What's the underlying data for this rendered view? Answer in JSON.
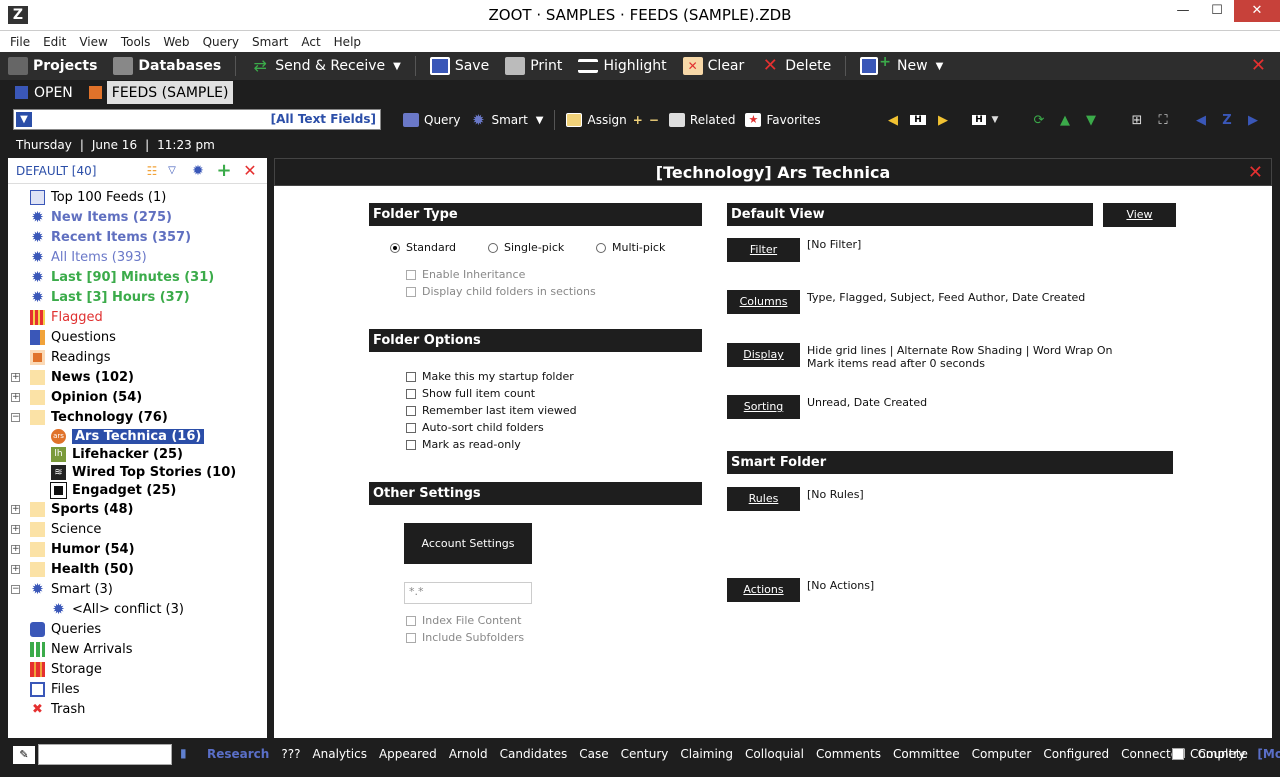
{
  "window": {
    "title": "ZOOT · SAMPLES · FEEDS (SAMPLE).ZDB",
    "minimize": "—",
    "maximize": "☐",
    "close": "✕",
    "logo": "Z"
  },
  "menu": [
    "File",
    "Edit",
    "View",
    "Tools",
    "Web",
    "Query",
    "Smart",
    "Act",
    "Help"
  ],
  "toolbar": {
    "projects": "Projects",
    "databases": "Databases",
    "send_receive": "Send & Receive",
    "save": "Save",
    "print": "Print",
    "highlight": "Highlight",
    "clear": "Clear",
    "delete": "Delete",
    "new": "New",
    "close": "✕"
  },
  "tabs": {
    "open": "OPEN",
    "active": "FEEDS (SAMPLE)"
  },
  "search": {
    "scope": "[All Text Fields]",
    "value": ""
  },
  "toolbar2": {
    "query": "Query",
    "smart": "Smart",
    "assign": "Assign",
    "related": "Related",
    "favorites": "Favorites"
  },
  "datebar": {
    "day": "Thursday",
    "date": "June 16",
    "time": "11:23 pm",
    "sep": "|"
  },
  "left": {
    "header": "DEFAULT  [40]",
    "items": {
      "top100": "Top 100 Feeds (1)",
      "new": "New Items (275)",
      "recent": "Recent Items (357)",
      "all": "All Items (393)",
      "last90": "Last [90] Minutes (31)",
      "last3": "Last [3] Hours (37)",
      "flagged": "Flagged",
      "questions": "Questions",
      "readings": "Readings",
      "news": "News (102)",
      "opinion": "Opinion (54)",
      "technology": "Technology (76)",
      "ars": "Ars Technica (16)",
      "lifehacker": "Lifehacker (25)",
      "wired": "Wired Top Stories (10)",
      "engadget": "Engadget (25)",
      "sports": "Sports (48)",
      "science": "Science",
      "humor": "Humor (54)",
      "health": "Health (50)",
      "smart": "Smart (3)",
      "conflict": "<All> conflict (3)",
      "queries": "Queries",
      "arrivals": "New Arrivals",
      "storage": "Storage",
      "files": "Files",
      "trash": "Trash"
    }
  },
  "main": {
    "title": "[Technology]  Ars Technica",
    "folder_type": {
      "heading": "Folder Type",
      "standard": "Standard",
      "single": "Single-pick",
      "multi": "Multi-pick",
      "inherit": "Enable Inheritance",
      "child_sections": "Display child folders in sections"
    },
    "folder_options": {
      "heading": "Folder Options",
      "startup": "Make this my startup folder",
      "fullcount": "Show full item count",
      "remember": "Remember last item viewed",
      "autosort": "Auto-sort child folders",
      "readonly": "Mark as read-only"
    },
    "other": {
      "heading": "Other Settings",
      "account": "Account Settings",
      "pattern": "*.*",
      "index": "Index File Content",
      "subfolders": "Include Subfolders"
    },
    "default_view": {
      "heading": "Default View",
      "view_btn": "View",
      "filter_btn": "Filter",
      "filter_val": "[No Filter]",
      "columns_btn": "Columns",
      "columns_val": "Type, Flagged, Subject, Feed Author, Date Created",
      "display_btn": "Display",
      "display_val1": "Hide grid lines | Alternate Row Shading | Word Wrap On",
      "display_val2": "Mark items read after 0 seconds",
      "sorting_btn": "Sorting",
      "sorting_val": "Unread, Date Created"
    },
    "smart_folder": {
      "heading": "Smart Folder",
      "rules_btn": "Rules",
      "rules_val": "[No Rules]",
      "actions_btn": "Actions",
      "actions_val": "[No Actions]"
    }
  },
  "statusbar": {
    "research": "Research",
    "words": [
      "???",
      "Analytics",
      "Appeared",
      "Arnold",
      "Candidates",
      "Case",
      "Century",
      "Claiming",
      "Colloquial",
      "Comments",
      "Committee",
      "Computer",
      "Configured",
      "Connected",
      "Country"
    ],
    "more": "[More]",
    "complete": "Complete"
  }
}
